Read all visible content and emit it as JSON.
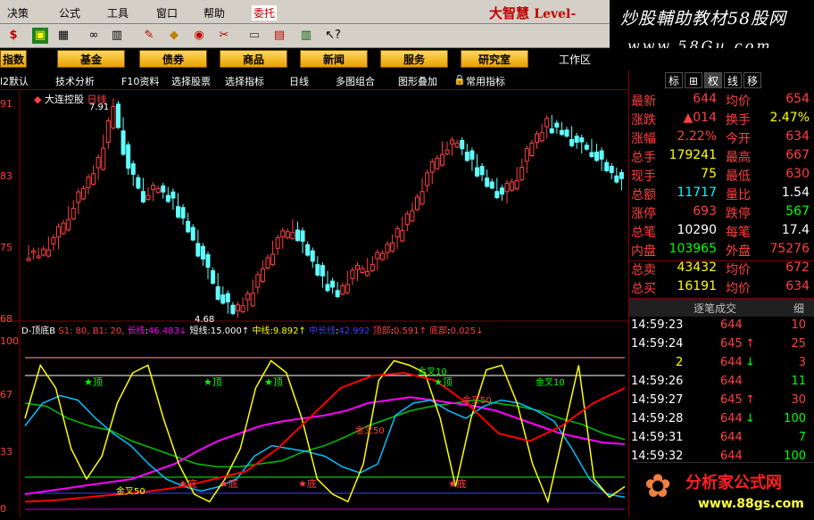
{
  "menu": {
    "items": [
      "决策",
      "公式",
      "工具",
      "窗口",
      "帮助"
    ],
    "order": "委托",
    "brand": "大智慧",
    "level": "Level-"
  },
  "watermark_top": {
    "line1": "炒股輔助教材58股网",
    "line2": "www.58Gu.com"
  },
  "nav": {
    "buttons": [
      "指数",
      "基金",
      "债券",
      "商品",
      "新闻",
      "服务",
      "研究室"
    ],
    "workspace": "工作区"
  },
  "subbar": {
    "items": [
      "l2默认",
      "技术分析",
      "F10资料",
      "选择股票",
      "选择指标",
      "日线",
      "多图组合",
      "图形叠加",
      "常用指标"
    ]
  },
  "chart": {
    "title": "大连控股",
    "period": "日线",
    "high_label": "7.91",
    "low_label": "4.68",
    "y_price": [
      "91",
      "83",
      "75",
      "68"
    ],
    "y_ind": [
      "100",
      "67",
      "33",
      "0"
    ],
    "ind_name": "D-顶底B",
    "ind_params": "S1: 80, B1: 20,",
    "ind_values": [
      {
        "name": "长线",
        "value": "46.483↓"
      },
      {
        "name": "短线",
        "value": "15.000↑"
      },
      {
        "name": "中线",
        "value": "9.892↑"
      },
      {
        "name": "中长线",
        "value": "42.992"
      },
      {
        "name": "顶部",
        "value": "0.591↑"
      },
      {
        "name": "底部",
        "value": "0.025↓"
      }
    ],
    "markers": {
      "top": "顶",
      "bottom": "底",
      "gold": "金叉",
      "gold10": "金叉10",
      "gold30": "金叉30",
      "gold50": "金叉50"
    }
  },
  "chart_data": {
    "type": "line",
    "title": "大连控股 日线",
    "ylim": [
      4.68,
      7.91
    ],
    "series": [
      {
        "name": "price",
        "values": [
          5.6,
          5.8,
          6.2,
          6.6,
          7.0,
          7.9,
          6.9,
          6.5,
          6.6,
          6.4,
          6.0,
          5.5,
          5.0,
          4.7,
          4.9,
          5.4,
          5.8,
          6.0,
          5.6,
          5.2,
          5.0,
          5.3,
          5.4,
          5.6,
          5.9,
          6.3,
          6.8,
          7.2,
          7.3,
          7.0,
          6.7,
          6.5,
          6.8,
          7.3,
          7.6,
          7.5,
          7.3,
          7.2,
          6.9,
          6.7
        ]
      },
      {
        "name": "长线",
        "values": [
          70,
          68,
          60,
          55,
          52,
          45,
          40,
          35,
          30,
          28,
          28,
          30,
          32,
          38,
          42,
          48,
          55,
          60,
          65,
          68,
          70,
          72,
          70,
          68,
          65,
          60,
          56,
          50,
          46
        ]
      },
      {
        "name": "中长线",
        "values": [
          10,
          12,
          14,
          16,
          18,
          20,
          25,
          30,
          38,
          45,
          50,
          55,
          58,
          60,
          62,
          65,
          70,
          72,
          74,
          72,
          70,
          68,
          65,
          60,
          55,
          50,
          47,
          44,
          43
        ]
      }
    ]
  },
  "right": {
    "tabs": [
      "标",
      "⊞",
      "权",
      "线",
      "移"
    ],
    "quote": [
      {
        "l": "最新",
        "v": "644",
        "vc": "#ff4040",
        "l2": "均价",
        "v2": "654",
        "v2c": "#ff4040"
      },
      {
        "l": "涨跌",
        "v": "▲014",
        "vc": "#ff4040",
        "l2": "换手",
        "v2": "2.47%",
        "v2c": "#ffff00"
      },
      {
        "l": "涨幅",
        "v": "2.22%",
        "vc": "#ff4040",
        "l2": "今开",
        "v2": "634",
        "v2c": "#ff4040"
      },
      {
        "l": "总手",
        "v": "179241",
        "vc": "#ffff00",
        "l2": "最高",
        "v2": "667",
        "v2c": "#ff4040"
      },
      {
        "l": "现手",
        "v": "75",
        "vc": "#ffff00",
        "l2": "最低",
        "v2": "630",
        "v2c": "#ff4040"
      },
      {
        "l": "总额",
        "v": "11717",
        "vc": "#00ffff",
        "l2": "量比",
        "v2": "1.54",
        "v2c": "#ffffff"
      },
      {
        "l": "涨停",
        "v": "693",
        "vc": "#ff4040",
        "l2": "跌停",
        "v2": "567",
        "v2c": "#00ff00"
      },
      {
        "l": "总笔",
        "v": "10290",
        "vc": "#ffffff",
        "l2": "每笔",
        "v2": "17.4",
        "v2c": "#ffffff"
      },
      {
        "l": "内盘",
        "v": "103965",
        "vc": "#00ff00",
        "l2": "外盘",
        "v2": "75276",
        "v2c": "#ff4040"
      },
      {
        "l": "总卖",
        "v": "43432",
        "vc": "#ffff00",
        "l2": "均价",
        "v2": "672",
        "v2c": "#ff4040"
      },
      {
        "l": "总买",
        "v": "16191",
        "vc": "#ffff00",
        "l2": "均价",
        "v2": "634",
        "v2c": "#ff4040"
      }
    ],
    "trade_title": "逐笔成交",
    "trade_btn": "细",
    "trades": [
      {
        "t": "14:59:23",
        "p": "644",
        "a": "",
        "v": "10",
        "vc": "#ff4040"
      },
      {
        "t": "14:59:24",
        "p": "645",
        "a": "↑",
        "v": "25",
        "vc": "#ff4040"
      },
      {
        "t": "",
        "p": "644",
        "a": "↓",
        "v": "3",
        "vc": "#ff4040",
        "pre": "2"
      },
      {
        "t": "14:59:26",
        "p": "644",
        "a": "",
        "v": "11",
        "vc": "#00ff00"
      },
      {
        "t": "14:59:27",
        "p": "645",
        "a": "↑",
        "v": "30",
        "vc": "#ff4040"
      },
      {
        "t": "14:59:28",
        "p": "644",
        "a": "↓",
        "v": "100",
        "vc": "#00ff00"
      },
      {
        "t": "14:59:31",
        "p": "644",
        "a": "",
        "v": "7",
        "vc": "#00ff00"
      },
      {
        "t": "14:59:32",
        "p": "644",
        "a": "",
        "v": "100",
        "vc": "#00ff00"
      }
    ]
  },
  "watermark_bottom": {
    "line1": "分析家公式网",
    "line2": "www.88gs.com"
  }
}
